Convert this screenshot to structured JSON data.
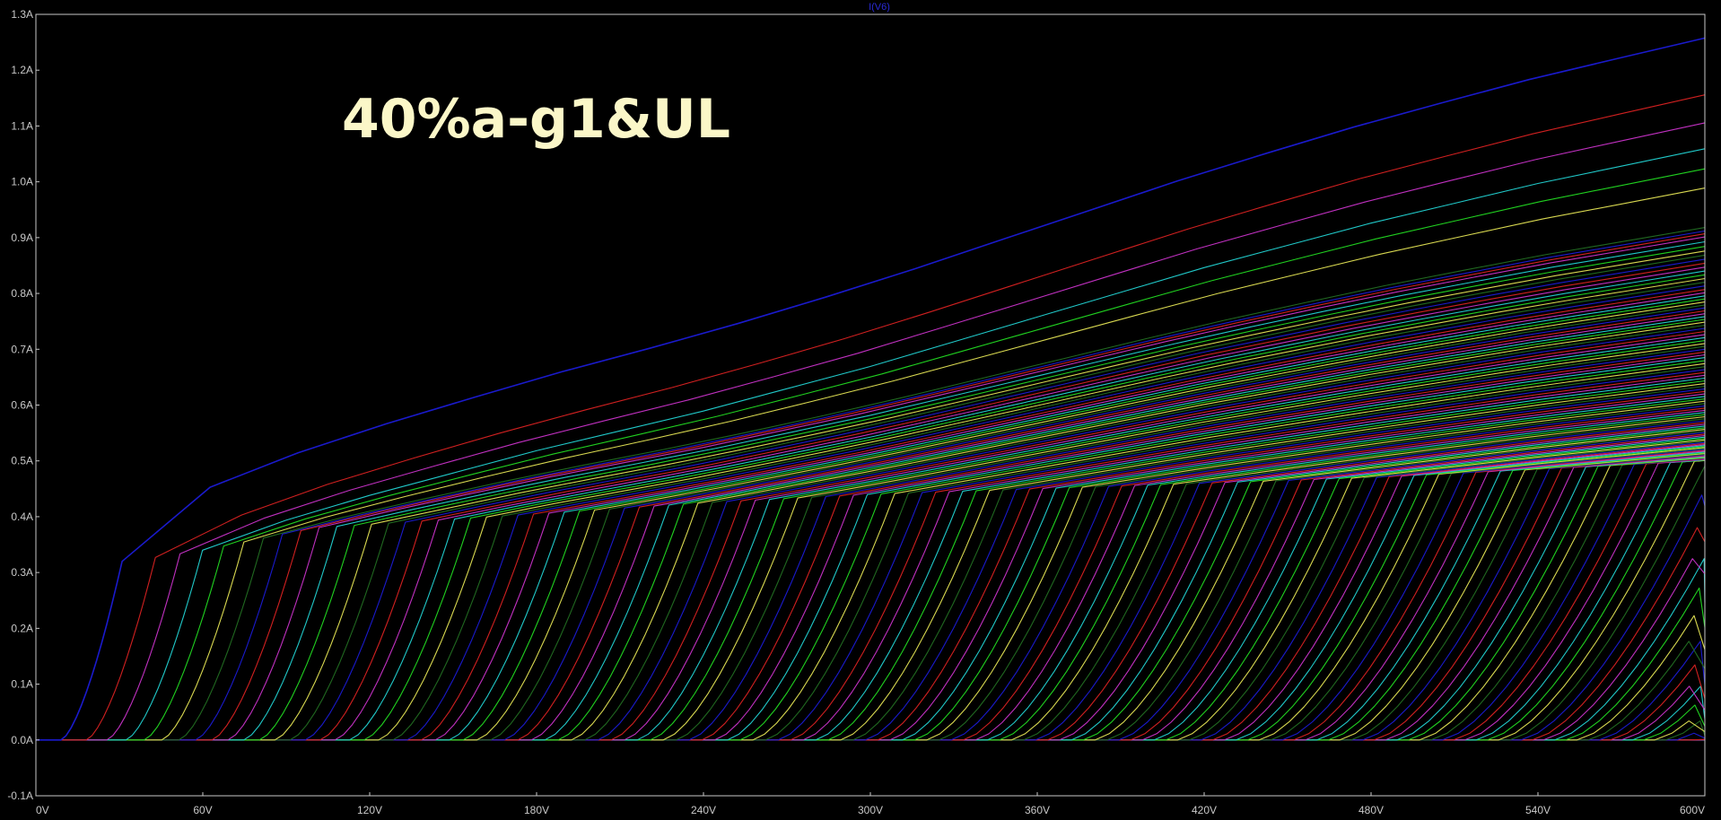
{
  "chart_data": {
    "type": "line",
    "title": "",
    "trace_label": "I(V6)",
    "annotation": "40%a-g1&UL",
    "xlabel": "",
    "ylabel": "",
    "xlim": [
      0,
      600
    ],
    "ylim": [
      -0.1,
      1.3
    ],
    "x_ticks": [
      {
        "value": 0,
        "label": "0V"
      },
      {
        "value": 60,
        "label": "60V"
      },
      {
        "value": 120,
        "label": "120V"
      },
      {
        "value": 180,
        "label": "180V"
      },
      {
        "value": 240,
        "label": "240V"
      },
      {
        "value": 300,
        "label": "300V"
      },
      {
        "value": 360,
        "label": "360V"
      },
      {
        "value": 420,
        "label": "420V"
      },
      {
        "value": 480,
        "label": "480V"
      },
      {
        "value": 540,
        "label": "540V"
      },
      {
        "value": 600,
        "label": "600V"
      }
    ],
    "y_ticks": [
      {
        "value": -0.1,
        "label": "-0.1A"
      },
      {
        "value": 0.0,
        "label": "0.0A"
      },
      {
        "value": 0.1,
        "label": "0.1A"
      },
      {
        "value": 0.2,
        "label": "0.2A"
      },
      {
        "value": 0.3,
        "label": "0.3A"
      },
      {
        "value": 0.4,
        "label": "0.4A"
      },
      {
        "value": 0.5,
        "label": "0.5A"
      },
      {
        "value": 0.6,
        "label": "0.6A"
      },
      {
        "value": 0.7,
        "label": "0.7A"
      },
      {
        "value": 0.8,
        "label": "0.8A"
      },
      {
        "value": 0.9,
        "label": "0.9A"
      },
      {
        "value": 1.0,
        "label": "1.0A"
      },
      {
        "value": 1.1,
        "label": "1.1A"
      },
      {
        "value": 1.2,
        "label": "1.2A"
      },
      {
        "value": 1.3,
        "label": "1.3A"
      }
    ],
    "grid": false,
    "colors": {
      "background": "#000000",
      "frame": "#c8c8c8",
      "tick_text": "#c8c8c8",
      "annotation": "#fbf7c8",
      "trace_title": "#2a2ad8"
    },
    "series_palette": [
      "#1a1acc",
      "#d02020",
      "#c030c0",
      "#20c8c8",
      "#20d020",
      "#d8d850",
      "#206820"
    ],
    "series_count": 150,
    "upper_envelope": [
      {
        "x": 9,
        "y": 0.0
      },
      {
        "x": 22,
        "y": 0.13
      },
      {
        "x": 34,
        "y": 0.32
      },
      {
        "x": 40,
        "y": 0.34
      },
      {
        "x": 60,
        "y": 0.4
      },
      {
        "x": 90,
        "y": 0.46
      },
      {
        "x": 120,
        "y": 0.51
      },
      {
        "x": 180,
        "y": 0.6
      },
      {
        "x": 240,
        "y": 0.68
      },
      {
        "x": 300,
        "y": 0.77
      },
      {
        "x": 360,
        "y": 0.87
      },
      {
        "x": 420,
        "y": 0.97
      },
      {
        "x": 480,
        "y": 1.06
      },
      {
        "x": 540,
        "y": 1.14
      },
      {
        "x": 600,
        "y": 1.21
      }
    ],
    "knee_line": [
      {
        "x": 34,
        "y": 0.32
      },
      {
        "x": 60,
        "y": 0.34
      },
      {
        "x": 100,
        "y": 0.38
      },
      {
        "x": 180,
        "y": 0.405
      },
      {
        "x": 240,
        "y": 0.425
      },
      {
        "x": 300,
        "y": 0.44
      },
      {
        "x": 360,
        "y": 0.45
      },
      {
        "x": 420,
        "y": 0.46
      },
      {
        "x": 480,
        "y": 0.47
      },
      {
        "x": 540,
        "y": 0.485
      },
      {
        "x": 600,
        "y": 0.5
      }
    ],
    "series_start_x": [
      9,
      680
    ],
    "series_rise_width": [
      22,
      80
    ],
    "series_slope_ratio": 0.6
  }
}
